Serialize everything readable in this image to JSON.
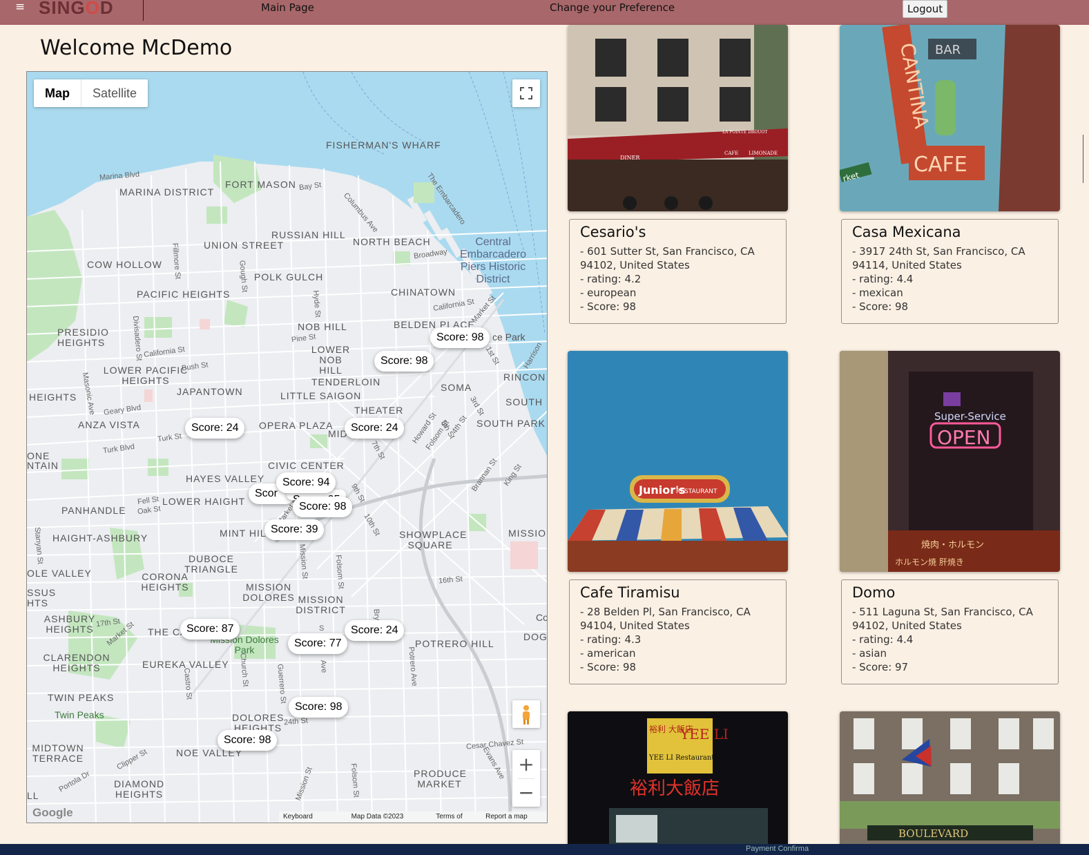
{
  "nav": {
    "brand_left": "SING",
    "brand_o": "O",
    "brand_right": "D",
    "menu_glyph": "≡",
    "links": [
      "Main Page",
      "Change your Preference"
    ],
    "logout": "Logout"
  },
  "welcome": "Welcome McDemo",
  "map": {
    "type_map": "Map",
    "type_satellite": "Satellite",
    "zoom_in": "+",
    "zoom_out": "−",
    "footer": [
      "Keyboard shortcuts",
      "Map Data ©2023 Google",
      "Terms of Use",
      "Report a map error"
    ],
    "google_logo": "Google",
    "neighborhoods": [
      "FISHERMAN'S WHARF",
      "MARINA DISTRICT",
      "FORT MASON",
      "RUSSIAN HILL",
      "NORTH BEACH",
      "UNION STREET",
      "COW HOLLOW",
      "POLK GULCH",
      "PACIFIC HEIGHTS",
      "CHINATOWN",
      "NOB HILL",
      "BELDEN PLACE",
      "PRESIDIO HEIGHTS",
      "LOWER NOB HILL",
      "LOWER PACIFIC HEIGHTS",
      "TENDERLOIN",
      "RINCON HILL",
      "JAPANTOWN",
      "LITTLE SAIGON",
      "SOMA",
      "HEIGHTS",
      "THEATER",
      "SOUTH B",
      "ANZA VISTA",
      "OPERA PLAZA",
      "MID",
      "SOUTH PARK",
      "ONE",
      "NTAIN",
      "CIVIC CENTER",
      "HAYES VALLEY",
      "LOWER HAIGHT",
      "PANHANDLE",
      "HAIGHT-ASHBURY",
      "MINT HIL",
      "SHOWPLACE SQUARE",
      "MISSIO",
      "DUBOCE TRIANGLE",
      "OLE VALLEY",
      "CORONA HEIGHTS",
      "MISSION DOLORES",
      "MISSION DISTRICT",
      "SSUS",
      "HTS",
      "ASHBURY HEIGHTS",
      "THE CA",
      "DOGP",
      "CLARENDON HEIGHTS",
      "EUREKA VALLEY",
      "POTRERO HILL",
      "TWIN PEAKS",
      "DOLORES HEIGHTS",
      "MIDTOWN TERRACE",
      "NOE VALLEY",
      "DIAMOND HEIGHTS",
      "PRODUCE MARKET",
      "LL"
    ],
    "poi": [
      "Central Embarcadero Piers Historic District",
      "Mission Dolores Park",
      "Twin Peaks",
      "ce Park",
      "Co"
    ],
    "streets": [
      "Marina Blvd",
      "Bay St",
      "Columbus Ave",
      "The Embarcadero",
      "Broadway",
      "Fillmore St",
      "Gough St",
      "Hyde St",
      "California St",
      "Market St",
      "Pine St",
      "Divisadero St",
      "California St",
      "Bush St",
      "Harrison",
      "1st St",
      "Geary Blvd",
      "Masonic Ave",
      "Turk St",
      "Turk Blvd",
      "Howard St",
      "4th St",
      "3rd St",
      "Folsom St",
      "7th St",
      "5th St",
      "Brannan St",
      "King St",
      "9th St",
      "10th St",
      "Fell St",
      "Oak St",
      "Market St",
      "Mission St",
      "Folsom St",
      "16th St",
      "17th St",
      "Market St",
      "Stanyan St",
      "Church St",
      "Guerrero St",
      "Bry",
      "Potrero Ave",
      "Castro St",
      "24th St",
      "Cesar Chavez St",
      "Clipper St",
      "Portola Dr",
      "Evans Ave",
      "Folsom St",
      "Mission St",
      "S",
      "Ave"
    ],
    "markers": [
      "Score: 98",
      "Score: 98",
      "Score: 24",
      "Score: 24",
      "Score: 94",
      "Scor",
      "Score: 98",
      "Score: 39",
      "Score: 87",
      "Score: 24",
      "Score: 77",
      "Score: 98",
      "Score: 98"
    ],
    "hidden_marker_fragment": "Score: 95"
  },
  "restaurants": [
    {
      "name": "Cesario's",
      "address": "- 601 Sutter St, San Francisco, CA 94102, United States",
      "rating": "- rating: 4.2",
      "cuisine": "- european",
      "score": "- Score: 98"
    },
    {
      "name": "Casa Mexicana",
      "address": "- 3917 24th St, San Francisco, CA 94114, United States",
      "rating": "- rating: 4.4",
      "cuisine": "- mexican",
      "score": "- Score: 98"
    },
    {
      "name": "Cafe Tiramisu",
      "address": "- 28 Belden Pl, San Francisco, CA 94104, United States",
      "rating": "- rating: 4.3",
      "cuisine": "- american",
      "score": "- Score: 98"
    },
    {
      "name": "Domo",
      "address": "- 511 Laguna St, San Francisco, CA 94102, United States",
      "rating": "- rating: 4.4",
      "cuisine": "- asian",
      "score": "- Score: 97"
    }
  ],
  "photo_text": {
    "cantina_sign": "CANTINA",
    "cantina_bar": "BAR",
    "cantina_cafe": "CAFE",
    "cantina_street": "rket",
    "juniors_sign": "Junior's",
    "juniors_restaurant": "RESTAURANT",
    "domo_super": "Super-Service",
    "domo_open": "OPEN",
    "domo_jp1": "焼肉・ホルモン",
    "domo_jp2": "ホルモン焼 肝焼き",
    "yeeli_left": "裕利 大飯店",
    "yeeli_en": "YEE LI Restaurant",
    "yeeli_right": "YEE LI",
    "yeeli_bottom": "裕利大飯店",
    "boulevard": "BOULEVARD",
    "cesario_diner": "DINER",
    "cesario_cafe": "CAFE",
    "cesario_limonade": "LIMONADE",
    "cesario_pointe": "LA POINTE DROUOT"
  },
  "taskbar_item": "Payment Confirma",
  "colors": {
    "nav": "#a8676a",
    "page_bg": "#fbf0e4",
    "water": "#aadaef",
    "park": "#c3e6bf",
    "map_land": "#eceef1"
  },
  "icons": [
    "hamburger-icon",
    "fullscreen-icon",
    "pegman-icon",
    "zoom-in-icon",
    "zoom-out-icon"
  ]
}
